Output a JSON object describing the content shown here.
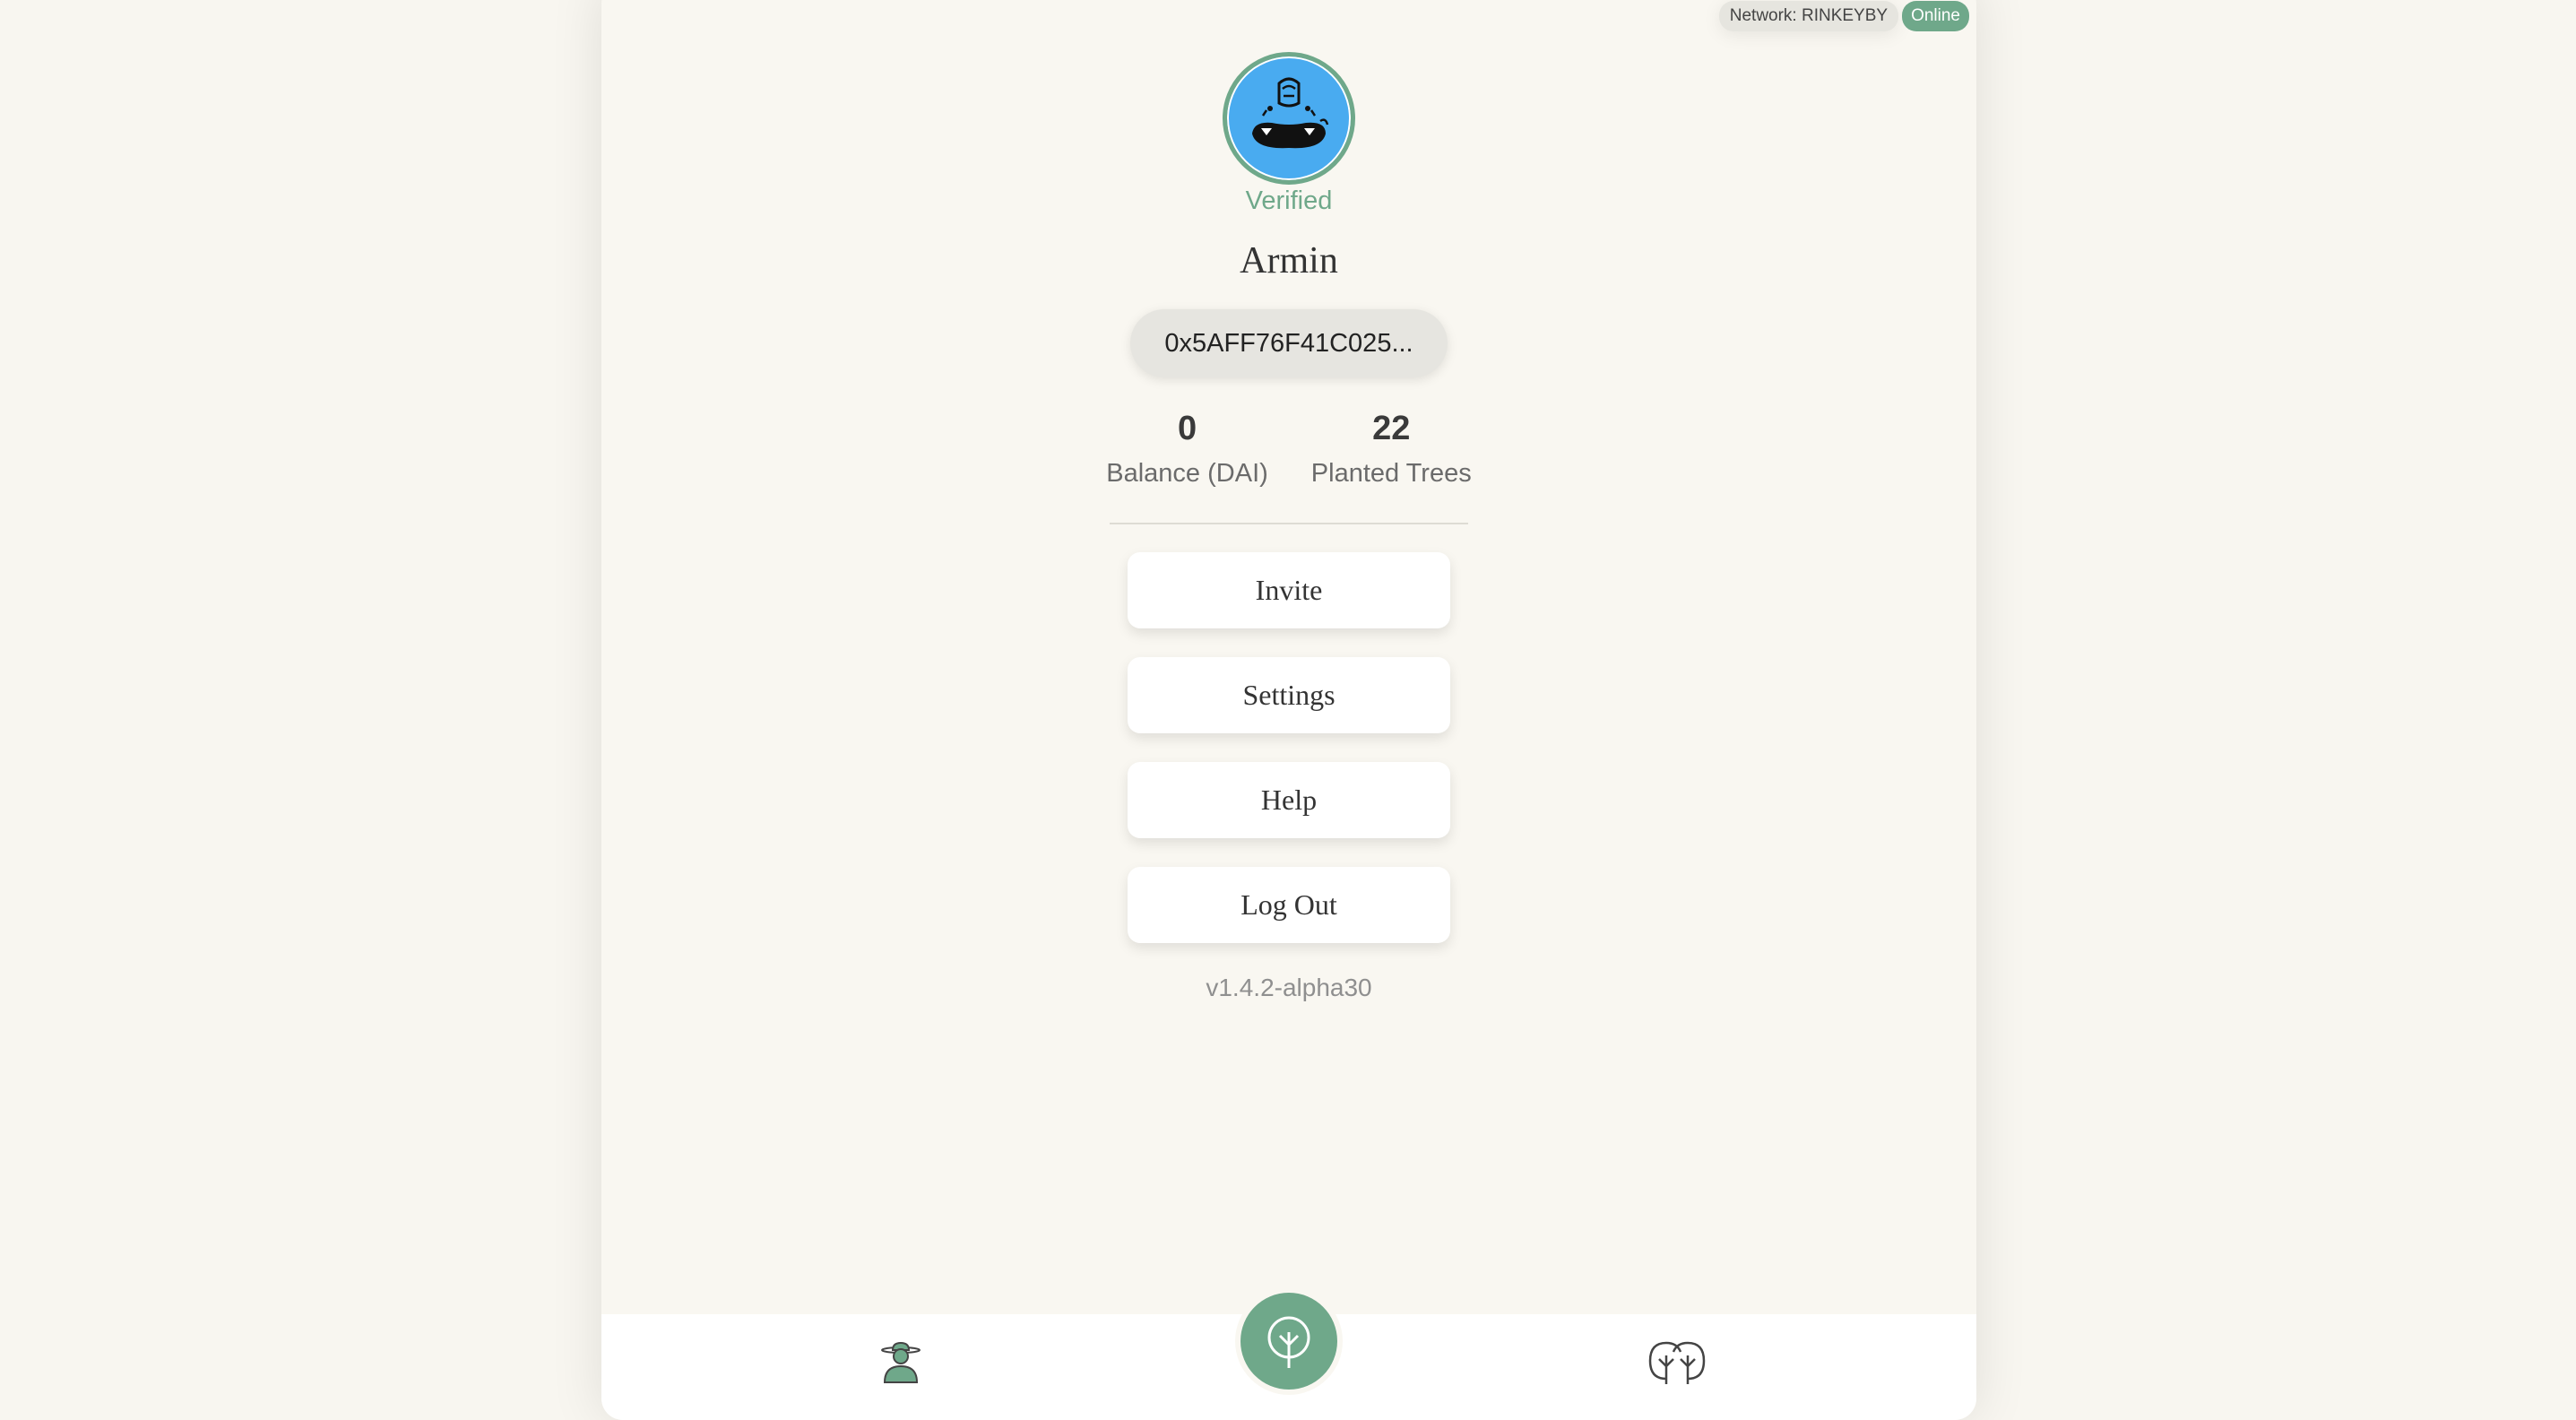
{
  "network": {
    "label": "Network: RINKEYBY",
    "status": "Online"
  },
  "profile": {
    "verified_label": "Verified",
    "name": "Armin",
    "wallet_address": "0x5AFF76F41C025...",
    "stats": [
      {
        "value": "0",
        "label": "Balance (DAI)"
      },
      {
        "value": "22",
        "label": "Planted Trees"
      }
    ]
  },
  "menu": {
    "invite": "Invite",
    "settings": "Settings",
    "help": "Help",
    "logout": "Log Out"
  },
  "version": "v1.4.2-alpha30",
  "colors": {
    "accent": "#6fa88a",
    "avatar_bg": "#49abf0",
    "background": "#f9f7f1"
  },
  "icons": {
    "nav_left": "gardener-profile-icon",
    "nav_center": "plant-tree-icon",
    "nav_right": "forest-icon"
  }
}
